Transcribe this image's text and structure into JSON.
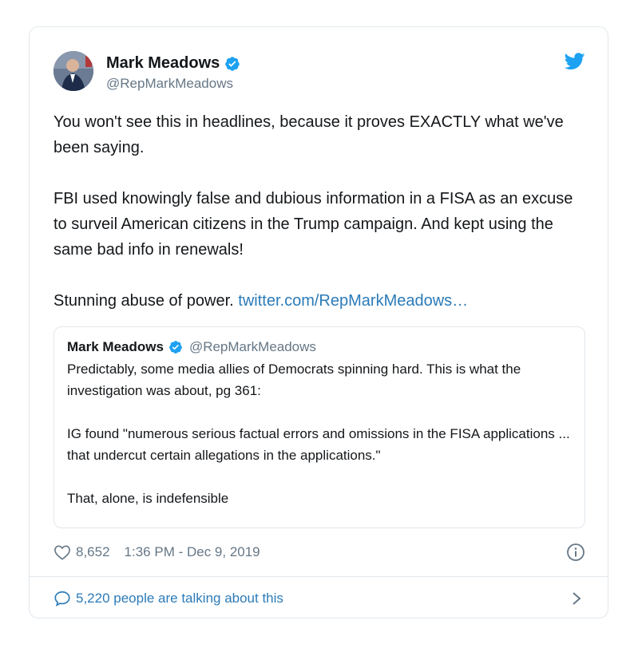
{
  "tweet": {
    "author": {
      "name": "Mark Meadows",
      "handle": "@RepMarkMeadows",
      "verified": true
    },
    "paragraphs": [
      "You won't see this in headlines, because it proves EXACTLY what we've been saying.",
      "FBI used knowingly false and dubious information in a FISA as an excuse to surveil American citizens in the Trump campaign. And kept using the same bad info in renewals!",
      "Stunning abuse of power."
    ],
    "link_text": "twitter.com/RepMarkMeadows…",
    "quoted": {
      "name": "Mark Meadows",
      "handle": "@RepMarkMeadows",
      "paragraphs": [
        "Predictably, some media allies of Democrats spinning hard. This is what the investigation was about, pg 361:",
        "IG found \"numerous serious factual errors and omissions in the FISA applications ... that undercut certain allegations in the applications.\"",
        "That, alone, is indefensible"
      ]
    },
    "likes": "8,652",
    "timestamp": "1:36 PM - Dec 9, 2019",
    "talking": "5,220 people are talking about this"
  },
  "colors": {
    "link": "#2b7bb9",
    "verified": "#1da1f2",
    "muted": "#657786",
    "border": "#e1e8ed"
  },
  "icons": [
    "avatar",
    "verified-badge-icon",
    "twitter-logo-icon",
    "heart-icon",
    "info-icon",
    "comment-bubble-icon",
    "chevron-right-icon"
  ]
}
